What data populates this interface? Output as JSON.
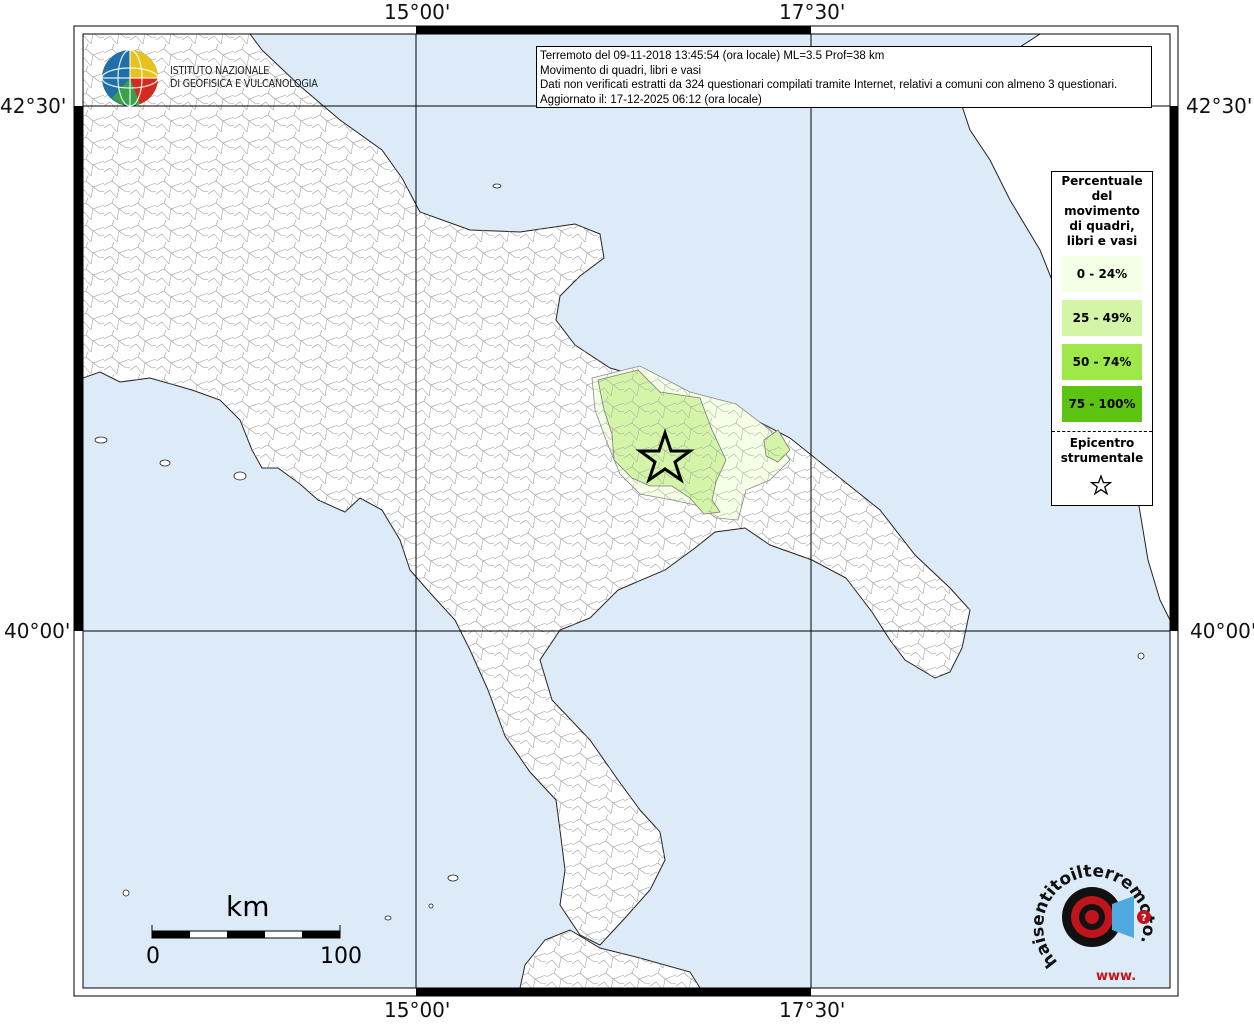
{
  "info": {
    "line1": "Terremoto del 09-11-2018 13:45:54 (ora locale) ML=3.5 Prof=38 km",
    "line2": "Movimento di quadri, libri e vasi",
    "line3": "Dati non verificati estratti da 324 questionari compilati tramite Internet, relativi a comuni con almeno 3 questionari.",
    "line4": "Aggiornato il: 17-12-2025 06:12 (ora locale)"
  },
  "coords": {
    "lon_west": "15°00'",
    "lon_east": "17°30'",
    "lat_north": "42°30'",
    "lat_south": "40°00'"
  },
  "legend": {
    "title_lines": [
      "Percentuale",
      "del",
      "movimento",
      "di quadri,",
      "libri e vasi"
    ],
    "classes": [
      {
        "label": "0 - 24%",
        "color": "#f5ffe6"
      },
      {
        "label": "25 - 49%",
        "color": "#d4f5a8"
      },
      {
        "label": "50 - 74%",
        "color": "#9ee84a"
      },
      {
        "label": "75 - 100%",
        "color": "#5cc411"
      }
    ],
    "epicenter_lines": [
      "Epicentro",
      "strumentale"
    ]
  },
  "logo": {
    "line1": "ISTITUTO NAZIONALE",
    "line2": "DI GEOFISICA E VULCANOLOGIA"
  },
  "scale": {
    "unit": "km",
    "start": "0",
    "end": "100"
  },
  "hst_logo": {
    "text": "haisentitoilterremoto.it",
    "www": "www."
  },
  "colors": {
    "sea": "#dcebf7",
    "land": "#ffffff",
    "accent": "#c0141b"
  }
}
